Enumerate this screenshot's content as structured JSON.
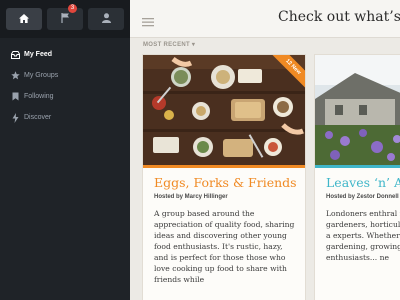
{
  "tabs": [
    {
      "name": "home",
      "icon": "home-icon",
      "active": true
    },
    {
      "name": "notifications",
      "icon": "flag-icon",
      "badge": "3",
      "active": false
    },
    {
      "name": "profile",
      "icon": "user-icon",
      "active": false
    }
  ],
  "sidebar": {
    "items": [
      {
        "label": "My Feed",
        "icon": "inbox-icon",
        "active": true
      },
      {
        "label": "My Groups",
        "icon": "star-icon",
        "active": false
      },
      {
        "label": "Following",
        "icon": "bookmark-icon",
        "active": false
      },
      {
        "label": "Discover",
        "icon": "lightning-icon",
        "active": false
      }
    ]
  },
  "header": {
    "title": "Check out what’s ne"
  },
  "feed": {
    "sort_label": "MOST RECENT ▾",
    "cards": [
      {
        "title": "Eggs, Forks & Friends",
        "host": "Hosted by Marcy Hillinger",
        "description": "A group based around the appreciation of quality food, sharing ideas and discovering other young food enthusiasts. It's rustic, hazy, and is perfect for those those who love cooking up food to share with friends while",
        "ribbon": "12 New",
        "accent": "#f08a24"
      },
      {
        "title": "Leaves ‘n’ A",
        "host": "Hosted by Zestor Donnell",
        "description": "Londoners enthral rooftop gardeners, horticulturalists, a experts. Whether y gardening, growing enthusiasts... ne",
        "accent": "#3fb6c9"
      }
    ]
  },
  "colors": {
    "sidebar_bg": "#1f2328",
    "orange_accent": "#f08a24",
    "teal_accent": "#3fb6c9",
    "badge_red": "#e0463c"
  }
}
